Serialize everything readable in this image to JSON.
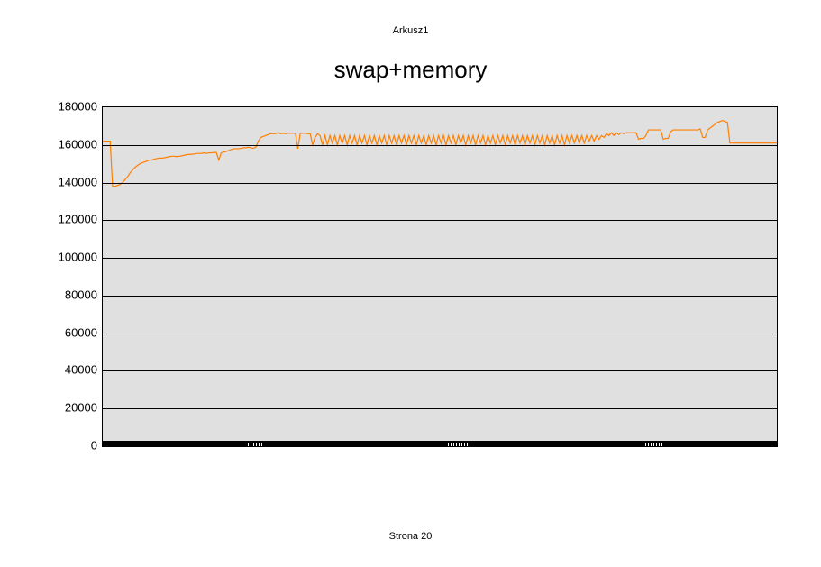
{
  "header": {
    "sheet_name": "Arkusz1"
  },
  "footer": {
    "page_label": "Strona 20"
  },
  "chart_data": {
    "type": "line",
    "title": "swap+memory",
    "xlabel": "",
    "ylabel": "",
    "ylim": [
      0,
      180000
    ],
    "y_ticks": [
      0,
      20000,
      40000,
      60000,
      80000,
      100000,
      120000,
      140000,
      160000,
      180000
    ],
    "grid": true,
    "series": [
      {
        "name": "swap+memory",
        "color": "#ff7f00",
        "values": [
          162000,
          162000,
          162000,
          162000,
          138000,
          138000,
          138500,
          139000,
          140000,
          141500,
          143000,
          145000,
          146500,
          148000,
          149000,
          150000,
          150500,
          151000,
          151500,
          152000,
          152000,
          152500,
          152800,
          153000,
          153000,
          153200,
          153500,
          153800,
          154000,
          154000,
          153800,
          154000,
          154200,
          154500,
          154800,
          155000,
          155000,
          155200,
          155500,
          155500,
          155500,
          155800,
          155500,
          155800,
          155800,
          156000,
          156000,
          152000,
          155800,
          156200,
          156500,
          157000,
          157500,
          158000,
          158000,
          158000,
          158200,
          158500,
          158500,
          158800,
          158500,
          158200,
          158800,
          162000,
          164000,
          164500,
          165000,
          165500,
          166000,
          166000,
          166000,
          166500,
          166000,
          166200,
          166000,
          166200,
          166200,
          166200,
          166200,
          158000,
          166200,
          166200,
          166200,
          166000,
          166000,
          160000,
          164000,
          166000,
          165000,
          160000,
          165000,
          160000,
          165000,
          161000,
          165000,
          160000,
          165000,
          161000,
          165000,
          160000,
          165000,
          161000,
          165000,
          160000,
          165000,
          161000,
          165000,
          160000,
          165000,
          161000,
          165000,
          160000,
          165000,
          161000,
          165000,
          160000,
          165000,
          161000,
          165000,
          160000,
          165000,
          161000,
          165000,
          160000,
          165000,
          161000,
          165000,
          160000,
          165000,
          161000,
          165000,
          160000,
          165000,
          161000,
          165000,
          160000,
          165000,
          161000,
          165000,
          160000,
          165000,
          161000,
          165000,
          160000,
          165000,
          161000,
          165000,
          160000,
          165000,
          161000,
          165000,
          160000,
          165000,
          161000,
          165000,
          160000,
          165000,
          161000,
          165000,
          160000,
          165000,
          161000,
          165000,
          160000,
          165000,
          161000,
          165000,
          160000,
          165000,
          161000,
          165000,
          160000,
          165000,
          161000,
          165000,
          160000,
          165000,
          161000,
          165000,
          160000,
          165000,
          161000,
          165000,
          160000,
          165000,
          161000,
          165000,
          160000,
          165000,
          161000,
          165000,
          161000,
          165000,
          161000,
          165000,
          161000,
          165000,
          162000,
          165000,
          162000,
          165000,
          163000,
          165000,
          164000,
          166000,
          165000,
          166500,
          165000,
          166500,
          165500,
          166500,
          166000,
          166500,
          166500,
          166500,
          166500,
          166500,
          163000,
          163500,
          163500,
          165000,
          168000,
          168000,
          168000,
          168000,
          168000,
          168000,
          163000,
          163500,
          163500,
          167000,
          168000,
          168000,
          168000,
          168000,
          168000,
          168000,
          168000,
          168000,
          168000,
          168000,
          168000,
          168500,
          164000,
          164000,
          168000,
          169000,
          170000,
          171000,
          172000,
          172500,
          173000,
          172500,
          172000,
          161000,
          161000,
          161000,
          161000,
          161000,
          161000,
          161000,
          161000,
          161000,
          161000,
          161000,
          161000,
          161000,
          161000,
          161000,
          161000,
          161000,
          161000,
          161000,
          161000
        ]
      }
    ],
    "x_tick_clusters": [
      [
        0.215,
        0.219,
        0.223,
        0.227,
        0.231,
        0.235
      ],
      [
        0.512,
        0.516,
        0.52,
        0.524,
        0.528,
        0.532,
        0.536,
        0.54,
        0.544
      ],
      [
        0.805,
        0.809,
        0.813,
        0.817,
        0.821,
        0.825,
        0.829
      ]
    ]
  }
}
